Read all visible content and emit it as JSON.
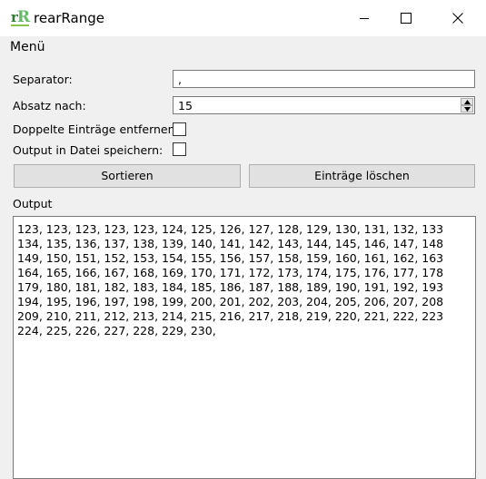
{
  "window": {
    "title": "rearRange",
    "icon": {
      "letter1": "r",
      "letter2": "R"
    }
  },
  "menu": {
    "label": "Menü"
  },
  "form": {
    "separator": {
      "label": "Separator:",
      "value": ","
    },
    "absatz": {
      "label": "Absatz nach:",
      "value": "15"
    },
    "duplicates": {
      "label": "Doppelte Einträge entfernen:",
      "checked": false
    },
    "save_file": {
      "label": "Output in Datei speichern:",
      "checked": false
    }
  },
  "buttons": {
    "sort": "Sortieren",
    "clear": "Einträge löschen"
  },
  "output": {
    "label": "Output",
    "lines": [
      "123, 123, 123, 123, 123, 124, 125, 126, 127, 128, 129, 130, 131, 132, 133",
      "134, 135, 136, 137, 138, 139, 140, 141, 142, 143, 144, 145, 146, 147, 148",
      "149, 150, 151, 152, 153, 154, 155, 156, 157, 158, 159, 160, 161, 162, 163",
      "164, 165, 166, 167, 168, 169, 170, 171, 172, 173, 174, 175, 176, 177, 178",
      "179, 180, 181, 182, 183, 184, 185, 186, 187, 188, 189, 190, 191, 192, 193",
      "194, 195, 196, 197, 198, 199, 200, 201, 202, 203, 204, 205, 206, 207, 208",
      "209, 210, 211, 212, 213, 214, 215, 216, 217, 218, 219, 220, 221, 222, 223",
      "224, 225, 226, 227, 228, 229, 230,"
    ]
  },
  "colors": {
    "icon_dark_green": "#2e7d32",
    "icon_light_green": "#66bb6a"
  }
}
